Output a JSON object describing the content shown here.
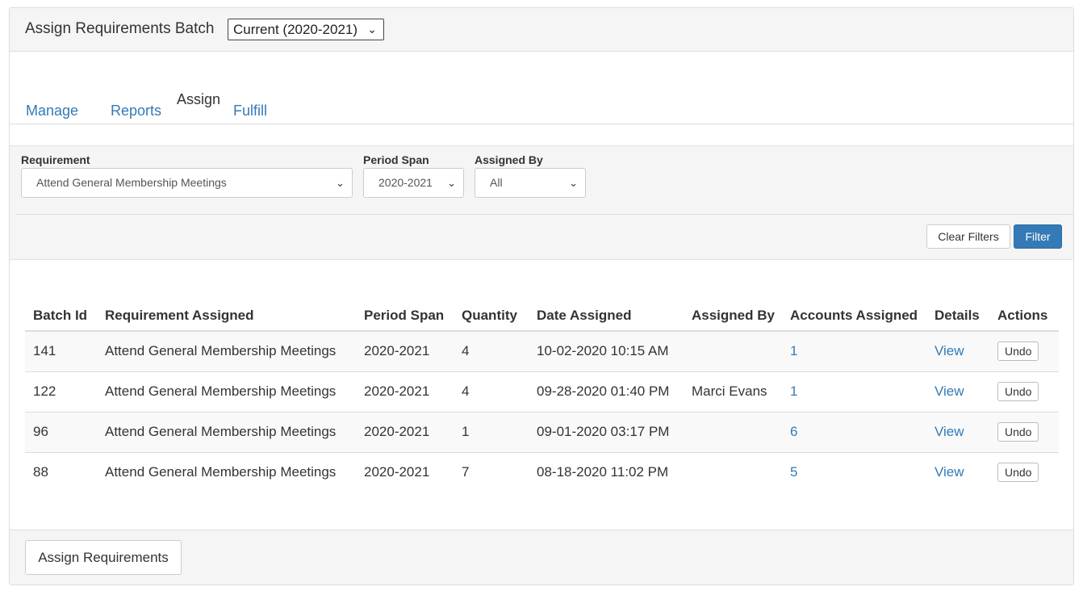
{
  "header": {
    "title": "Assign Requirements Batch",
    "batch_select": "Current (2020-2021)"
  },
  "tabs": [
    {
      "label": "Manage",
      "active": false
    },
    {
      "label": "Reports",
      "active": false
    },
    {
      "label": "Assign",
      "active": true
    },
    {
      "label": "Fulfill",
      "active": false
    }
  ],
  "filters": {
    "requirement": {
      "label": "Requirement",
      "value": "Attend General Membership Meetings"
    },
    "period_span": {
      "label": "Period Span",
      "value": "2020-2021"
    },
    "assigned_by": {
      "label": "Assigned By",
      "value": "All"
    },
    "clear_label": "Clear Filters",
    "filter_label": "Filter"
  },
  "table": {
    "columns": [
      "Batch Id",
      "Requirement Assigned",
      "Period Span",
      "Quantity",
      "Date Assigned",
      "Assigned By",
      "Accounts Assigned",
      "Details",
      "Actions"
    ],
    "rows": [
      {
        "batch_id": "141",
        "requirement": "Attend General Membership Meetings",
        "period": "2020-2021",
        "quantity": "4",
        "date": "10-02-2020 10:15 AM",
        "assigned_by": "",
        "accounts": "1",
        "details": "View",
        "action": "Undo"
      },
      {
        "batch_id": "122",
        "requirement": "Attend General Membership Meetings",
        "period": "2020-2021",
        "quantity": "4",
        "date": "09-28-2020 01:40 PM",
        "assigned_by": "Marci Evans",
        "accounts": "1",
        "details": "View",
        "action": "Undo"
      },
      {
        "batch_id": "96",
        "requirement": "Attend General Membership Meetings",
        "period": "2020-2021",
        "quantity": "1",
        "date": "09-01-2020 03:17 PM",
        "assigned_by": "",
        "accounts": "6",
        "details": "View",
        "action": "Undo"
      },
      {
        "batch_id": "88",
        "requirement": "Attend General Membership Meetings",
        "period": "2020-2021",
        "quantity": "7",
        "date": "08-18-2020 11:02 PM",
        "assigned_by": "",
        "accounts": "5",
        "details": "View",
        "action": "Undo"
      }
    ]
  },
  "footer": {
    "assign_button": "Assign Requirements"
  },
  "colors": {
    "link": "#337ab7",
    "primary": "#337ab7"
  }
}
